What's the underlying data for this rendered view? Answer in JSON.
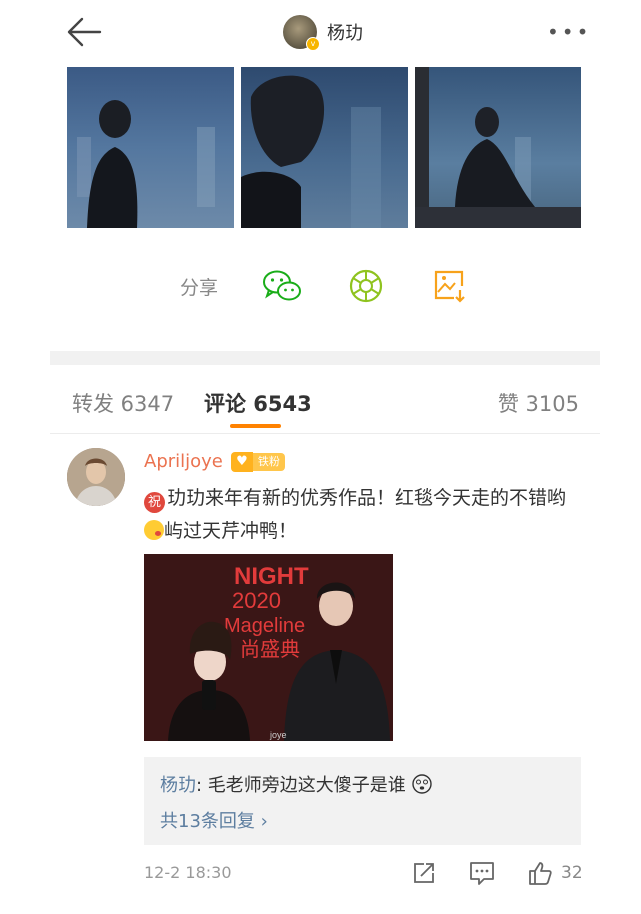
{
  "header": {
    "title": "杨玏",
    "back_icon": "arrow-left-icon",
    "more_label": "•••"
  },
  "share": {
    "label": "分享",
    "icons": [
      "wechat-icon",
      "moments-icon",
      "save-image-icon"
    ]
  },
  "tabs": {
    "repost": "转发 6347",
    "comment": "评论 6543",
    "like": "赞 3105"
  },
  "comment": {
    "username": "Apriljoye",
    "fan_badge": "铁粉",
    "badge_prefix": "祝",
    "text_part1": "玏玏来年有新的优秀作品！红毯今天走的不错哟",
    "text_part2": "屿过天芹冲鸭！",
    "reply": {
      "author": "杨玏",
      "text": ": 毛老师旁边这大傻子是谁"
    },
    "reply_more": "共13条回复 ›",
    "time": "12-2 18:30",
    "like_count": "32",
    "photo_text": {
      "night": "NIGHT",
      "year": "2020",
      "mageline": "Mageline",
      "chinese": "尚盛典",
      "watermark": "joye"
    }
  },
  "colors": {
    "accent": "#ff8200",
    "username": "#eb7350",
    "link": "#5d7ea0",
    "wechat": "#1aad19",
    "save": "#f7a21b"
  }
}
